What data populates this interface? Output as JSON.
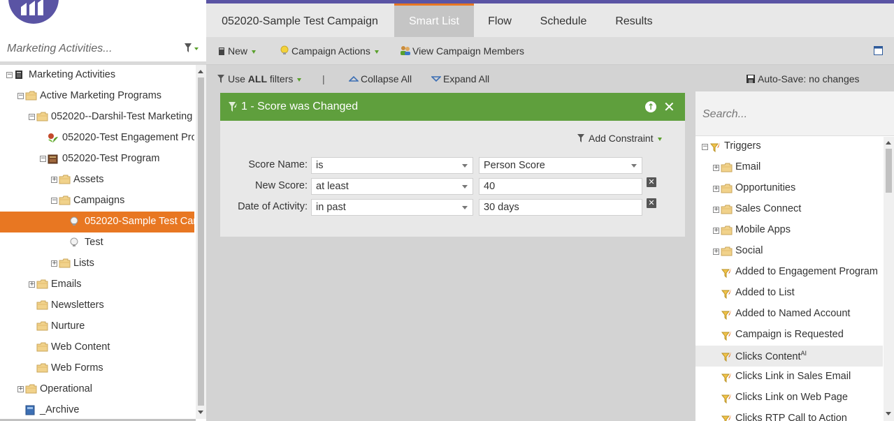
{
  "app": {
    "accent": "#e87722",
    "brand": "#5a54a4",
    "filter_green": "#5f9f3d"
  },
  "left_nav": {
    "search_placeholder": "Marketing Activities...",
    "tree": [
      {
        "label": "Marketing Activities",
        "icon": "marketing-activities-icon",
        "toggle": "−"
      },
      {
        "label": "Active Marketing Programs",
        "icon": "folder-icon",
        "toggle": "−"
      },
      {
        "label": "052020--Darshil-Test Marketing",
        "icon": "folder-icon",
        "toggle": "−"
      },
      {
        "label": "052020-Test Engagement Pro",
        "icon": "engagement-program-icon",
        "toggle": ""
      },
      {
        "label": "052020-Test Program",
        "icon": "program-icon",
        "toggle": "−"
      },
      {
        "label": "Assets",
        "icon": "folder-icon",
        "toggle": "+"
      },
      {
        "label": "Campaigns",
        "icon": "folder-icon",
        "toggle": "−"
      },
      {
        "label": "052020-Sample Test Can",
        "icon": "smart-campaign-icon",
        "toggle": "",
        "selected": true
      },
      {
        "label": "Test",
        "icon": "smart-campaign-icon",
        "toggle": ""
      },
      {
        "label": "Lists",
        "icon": "folder-icon",
        "toggle": "+"
      },
      {
        "label": "Emails",
        "icon": "folder-icon",
        "toggle": "+"
      },
      {
        "label": "Newsletters",
        "icon": "folder-icon",
        "toggle": ""
      },
      {
        "label": "Nurture",
        "icon": "folder-icon",
        "toggle": ""
      },
      {
        "label": "Web Content",
        "icon": "folder-icon",
        "toggle": ""
      },
      {
        "label": "Web Forms",
        "icon": "folder-icon",
        "toggle": ""
      },
      {
        "label": "Operational",
        "icon": "folder-icon",
        "toggle": "+"
      },
      {
        "label": "_Archive",
        "icon": "archive-icon",
        "toggle": ""
      }
    ]
  },
  "tabs": {
    "campaign": "052020-Sample Test Campaign",
    "smart_list": "Smart List",
    "flow": "Flow",
    "schedule": "Schedule",
    "results": "Results"
  },
  "toolbar": {
    "new": "New",
    "campaign_actions": "Campaign Actions",
    "view_members": "View Campaign Members"
  },
  "filterbar": {
    "use": "Use",
    "all": "ALL",
    "filters": "filters",
    "divider": "|",
    "collapse_all": "Collapse All",
    "expand_all": "Expand All",
    "autosave": "Auto-Save: no changes"
  },
  "filter_card": {
    "title": "1 - Score was Changed",
    "add_constraint": "Add Constraint",
    "rows": [
      {
        "label": "Score Name:",
        "operator": "is",
        "value": "Person Score",
        "value_is_dropdown": true,
        "removable": false
      },
      {
        "label": "New Score:",
        "operator": "at least",
        "value": "40",
        "value_is_dropdown": false,
        "removable": true
      },
      {
        "label": "Date of Activity:",
        "operator": "in past",
        "value": "30 days",
        "value_is_dropdown": false,
        "removable": true
      }
    ]
  },
  "right_panel": {
    "search_placeholder": "Search...",
    "items": [
      {
        "label": "Triggers",
        "icon": "trigger-icon",
        "toggle": "−"
      },
      {
        "label": "Email",
        "icon": "folder-icon",
        "toggle": "+"
      },
      {
        "label": "Opportunities",
        "icon": "folder-icon",
        "toggle": "+"
      },
      {
        "label": "Sales Connect",
        "icon": "folder-icon",
        "toggle": "+"
      },
      {
        "label": "Mobile Apps",
        "icon": "folder-icon",
        "toggle": "+"
      },
      {
        "label": "Social",
        "icon": "folder-icon",
        "toggle": "+"
      },
      {
        "label": "Added to Engagement Program",
        "icon": "trigger-icon",
        "toggle": ""
      },
      {
        "label": "Added to List",
        "icon": "trigger-icon",
        "toggle": ""
      },
      {
        "label": "Added to Named Account",
        "icon": "trigger-icon",
        "toggle": ""
      },
      {
        "label": "Campaign is Requested",
        "icon": "trigger-icon",
        "toggle": ""
      },
      {
        "label": "Clicks Content",
        "sup": "AI",
        "icon": "trigger-icon",
        "toggle": "",
        "hover": true
      },
      {
        "label": "Clicks Link in Sales Email",
        "icon": "trigger-icon",
        "toggle": ""
      },
      {
        "label": "Clicks Link on Web Page",
        "icon": "trigger-icon",
        "toggle": ""
      },
      {
        "label": "Clicks RTP Call to Action",
        "icon": "trigger-icon",
        "toggle": ""
      }
    ]
  }
}
